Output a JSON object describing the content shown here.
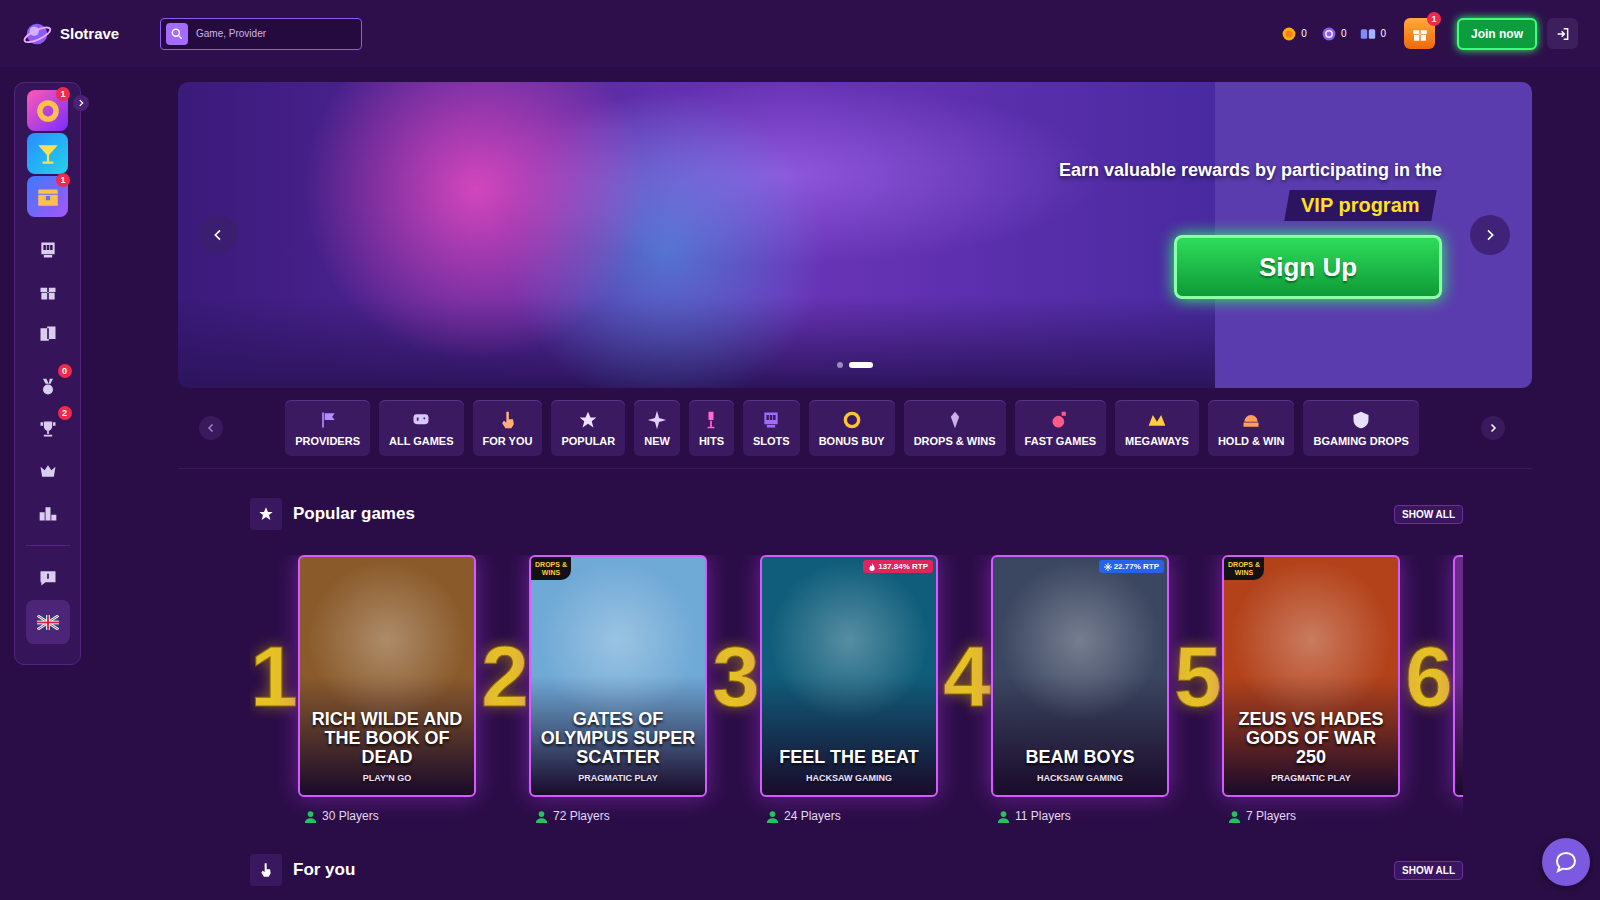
{
  "header": {
    "logo": "Slotrave",
    "search_placeholder": "Game, Provider",
    "balances": [
      {
        "kind": "coin",
        "value": "0"
      },
      {
        "kind": "spin",
        "value": "0"
      },
      {
        "kind": "bb",
        "value": "0"
      }
    ],
    "gift_badge": "1",
    "join_label": "Join now"
  },
  "sidebar": {
    "groups": [
      [
        {
          "kind": "wheel",
          "badge": "1",
          "selected": false
        },
        {
          "kind": "cocktail",
          "badge": "",
          "selected": false
        },
        {
          "kind": "chest",
          "badge": "1",
          "selected": false
        }
      ],
      [
        {
          "kind": "slot",
          "badge": "",
          "selected": false
        },
        {
          "kind": "gift",
          "badge": "",
          "selected": false
        },
        {
          "kind": "cards",
          "badge": "",
          "selected": false
        }
      ],
      [
        {
          "kind": "medal",
          "badge": "0",
          "selected": false
        },
        {
          "kind": "trophy",
          "badge": "2",
          "selected": false
        },
        {
          "kind": "crown",
          "badge": "",
          "selected": false
        },
        {
          "kind": "podium",
          "badge": "",
          "selected": false
        }
      ],
      [
        {
          "kind": "help",
          "badge": "",
          "selected": false
        },
        {
          "kind": "language",
          "badge": "",
          "selected": true
        }
      ]
    ]
  },
  "banner": {
    "headline": "Earn valuable rewards by participating in the",
    "highlight": "VIP program",
    "cta": "Sign Up",
    "slides": [
      {
        "selected": false
      },
      {
        "selected": true
      }
    ]
  },
  "categories": [
    {
      "kind": "providers",
      "label": "PROVIDERS",
      "selected": false
    },
    {
      "kind": "all_games",
      "label": "ALL GAMES",
      "selected": false
    },
    {
      "kind": "for_you",
      "label": "FOR YOU",
      "selected": false
    },
    {
      "kind": "popular",
      "label": "POPULAR",
      "selected": false
    },
    {
      "kind": "new",
      "label": "NEW",
      "selected": false
    },
    {
      "kind": "hits",
      "label": "HITS",
      "selected": false
    },
    {
      "kind": "slots",
      "label": "SLOTS",
      "selected": false
    },
    {
      "kind": "bonus_buy",
      "label": "BONUS BUY",
      "selected": false
    },
    {
      "kind": "drops_wins",
      "label": "DROPS & WINS",
      "selected": false
    },
    {
      "kind": "fast_games",
      "label": "FAST GAMES",
      "selected": false
    },
    {
      "kind": "megaways",
      "label": "MEGAWAYS",
      "selected": false
    },
    {
      "kind": "hold_win",
      "label": "HOLD & WIN",
      "selected": false
    },
    {
      "kind": "bgaming_drops",
      "label": "BGAMING DROPS",
      "selected": false
    }
  ],
  "popular": {
    "title": "Popular games",
    "show_all": "SHOW ALL",
    "games": [
      {
        "rank": "1",
        "title": "RICH WILDE AND THE BOOK OF DEAD",
        "provider": "PLAY'N GO",
        "players": "30 Players",
        "rtp": "",
        "rtp_kind": "",
        "corner": "",
        "color": "#8a5a2a"
      },
      {
        "rank": "2",
        "title": "GATES OF OLYMPUS SUPER SCATTER",
        "provider": "PRAGMATIC PLAY",
        "players": "72 Players",
        "rtp": "",
        "rtp_kind": "",
        "corner": "DROPS & WINS",
        "color": "#6fa9d6"
      },
      {
        "rank": "3",
        "title": "FEEL THE BEAT",
        "provider": "HACKSAW GAMING",
        "players": "24 Players",
        "rtp": "137.84% RTP",
        "rtp_kind": "hot",
        "corner": "",
        "color": "#0f5d7a"
      },
      {
        "rank": "4",
        "title": "BEAM BOYS",
        "provider": "HACKSAW GAMING",
        "players": "11 Players",
        "rtp": "22.77% RTP",
        "rtp_kind": "cold",
        "corner": "",
        "color": "#3b4660"
      },
      {
        "rank": "5",
        "title": "ZEUS VS HADES GODS OF WAR 250",
        "provider": "PRAGMATIC PLAY",
        "players": "7 Players",
        "rtp": "",
        "rtp_kind": "",
        "corner": "DROPS & WINS",
        "color": "#b3421a"
      },
      {
        "rank": "6",
        "title": "",
        "provider": "",
        "players": "",
        "rtp": "",
        "rtp_kind": "",
        "corner": "",
        "color": "#6a2a8a"
      }
    ]
  },
  "for_you": {
    "title": "For you",
    "show_all": "SHOW ALL"
  }
}
